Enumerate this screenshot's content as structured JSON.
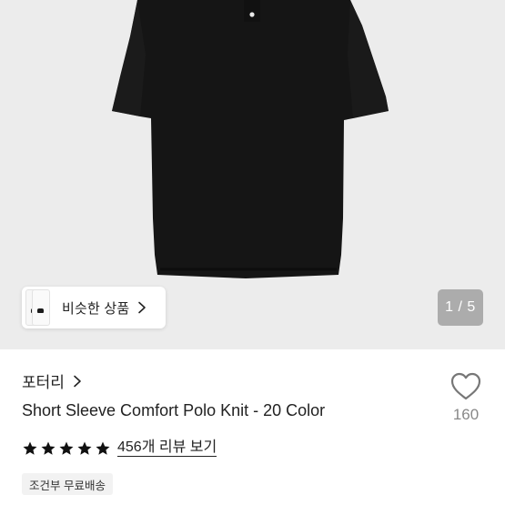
{
  "gallery": {
    "similar_label": "비슷한 상품",
    "counter": "1 / 5"
  },
  "product": {
    "brand": "포터리",
    "title": "Short Sleeve Comfort Polo Knit - 20 Color",
    "rating": 5,
    "review_link": "456개 리뷰 보기",
    "shipping_badge": "조건부 무료배송",
    "like_count": "160"
  },
  "icons": {
    "brand": "chevron-right-icon",
    "similar": "chevron-right-icon",
    "like": "heart-outline-icon",
    "star": "star-filled-icon"
  },
  "colors": {
    "hero_bg": "#ececec",
    "garment": "#151515",
    "star": "#111111",
    "like_count": "#888888"
  }
}
